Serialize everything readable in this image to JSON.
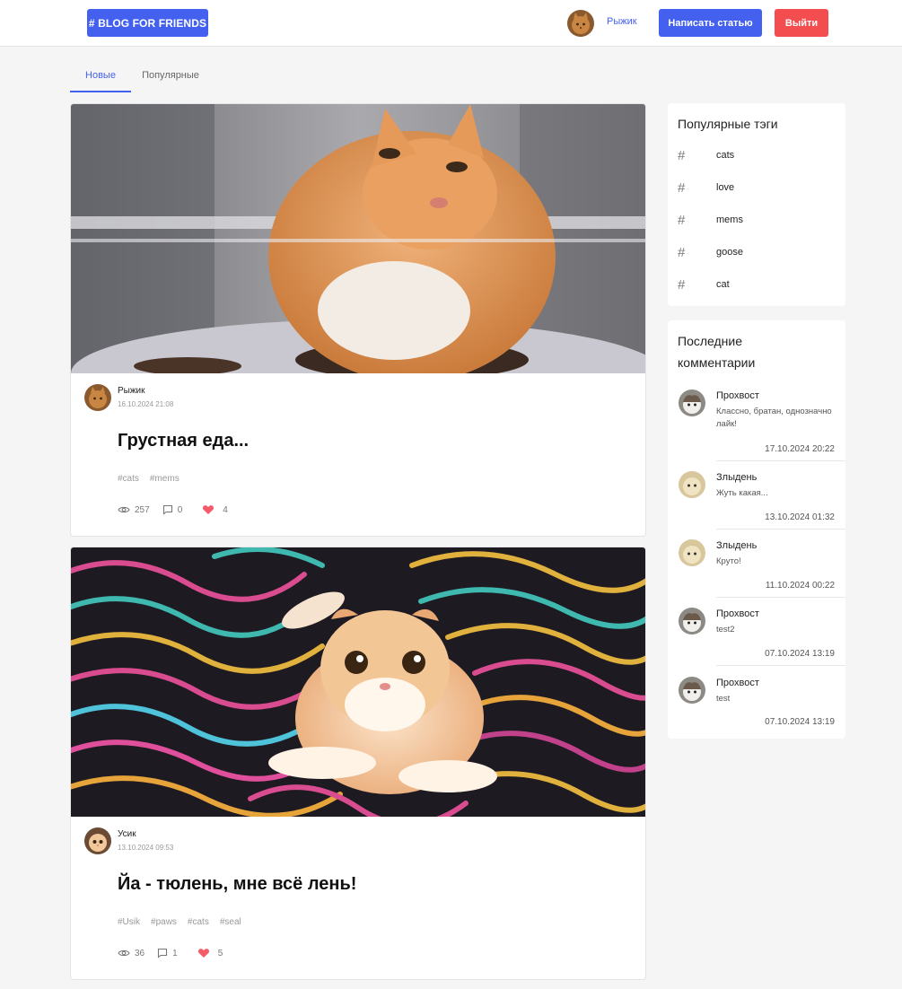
{
  "header": {
    "logo": "# BLOG FOR FRIENDS",
    "user_name": "Рыжик",
    "write_button": "Написать статью",
    "logout_button": "Выйти"
  },
  "tabs": [
    {
      "label": "Новые"
    },
    {
      "label": "Популярные"
    }
  ],
  "posts": [
    {
      "author": "Рыжик",
      "date": "16.10.2024 21:08",
      "title": "Грустная еда...",
      "tags": [
        "#cats",
        "#mems"
      ],
      "views": "257",
      "comments": "0",
      "likes": "4"
    },
    {
      "author": "Усик",
      "date": "13.10.2024 09:53",
      "title": "Йа - тюлень, мне всё лень!",
      "tags": [
        "#Usik",
        "#paws",
        "#cats",
        "#seal"
      ],
      "views": "36",
      "comments": "1",
      "likes": "5"
    }
  ],
  "sidebar": {
    "tags_title": "Популярные тэги",
    "tags": [
      "cats",
      "love",
      "mems",
      "goose",
      "cat"
    ],
    "comments_title_line1": "Последние",
    "comments_title_line2": "комментарии",
    "comments": [
      {
        "name": "Прохвост",
        "text": "Классно, братан, однозначно лайк!",
        "date": "17.10.2024 20:22"
      },
      {
        "name": "Злыдень",
        "text": "Жуть какая...",
        "date": "13.10.2024 01:32"
      },
      {
        "name": "Злыдень",
        "text": "Круто!",
        "date": "11.10.2024 00:22"
      },
      {
        "name": "Прохвост",
        "text": "test2",
        "date": "07.10.2024 13:19"
      },
      {
        "name": "Прохвост",
        "text": "test",
        "date": "07.10.2024 13:19"
      }
    ]
  },
  "colors": {
    "accent": "#4361ee",
    "danger": "#f44d4f",
    "like": "#f45b69"
  }
}
